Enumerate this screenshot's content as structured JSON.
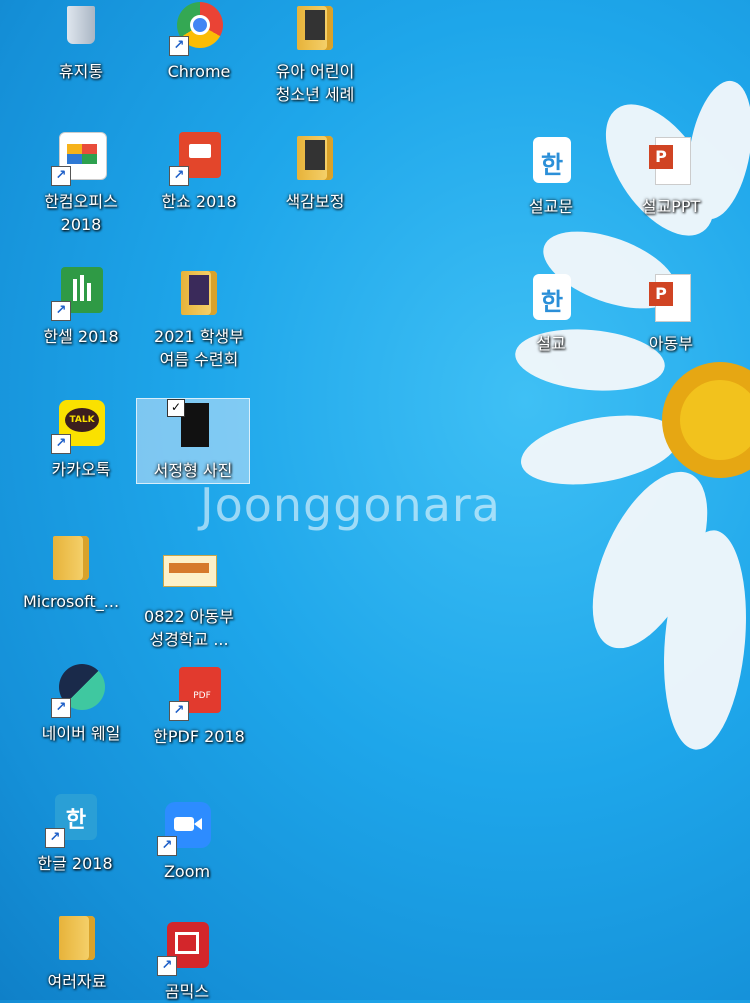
{
  "desktop": {
    "icons": [
      {
        "label_lines": [
          "휴지통"
        ]
      },
      {
        "label_lines": [
          "Chrome"
        ]
      },
      {
        "label_lines": [
          "유아 어린이",
          "청소년 세례"
        ]
      },
      {
        "label_lines": [
          "한컴오피스",
          "2018"
        ]
      },
      {
        "label_lines": [
          "한쇼 2018"
        ]
      },
      {
        "label_lines": [
          "색감보정"
        ]
      },
      {
        "label_lines": [
          "설교문"
        ]
      },
      {
        "label_lines": [
          "설교PPT"
        ]
      },
      {
        "label_lines": [
          "한셀 2018"
        ]
      },
      {
        "label_lines": [
          "2021 학생부",
          "여름 수련회"
        ]
      },
      {
        "label_lines": [
          "설교"
        ]
      },
      {
        "label_lines": [
          "아동부"
        ]
      },
      {
        "label_lines": [
          "카카오톡"
        ]
      },
      {
        "label_lines": [
          "서정형 사진"
        ]
      },
      {
        "label_lines": [
          "Microsoft_..."
        ]
      },
      {
        "label_lines": [
          "0822 아동부",
          "성경학교 ..."
        ]
      },
      {
        "label_lines": [
          "네이버 웨일"
        ]
      },
      {
        "label_lines": [
          "한PDF 2018"
        ]
      },
      {
        "label_lines": [
          "한글 2018"
        ]
      },
      {
        "label_lines": [
          "Zoom"
        ]
      },
      {
        "label_lines": [
          "여러자료"
        ]
      },
      {
        "label_lines": [
          "곰믹스"
        ]
      }
    ],
    "kakao_badge": "TALK",
    "pdf_badge": "PDF",
    "hangul_glyph": "한",
    "ppt_glyph": "P",
    "watermark": "Joonggonara"
  }
}
